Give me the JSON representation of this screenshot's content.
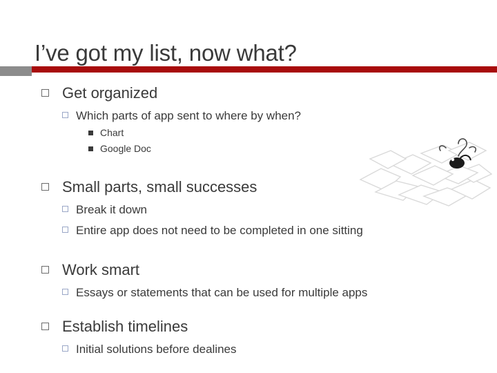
{
  "slide": {
    "title": "I’ve got my list, now what?",
    "colors": {
      "accent_red": "#a80b0b",
      "accent_gray": "#8c8c8c",
      "text": "#3a3a3a",
      "sub_bullet": "#9aa7c7"
    },
    "bullets": [
      {
        "level": 1,
        "text": "Get organized"
      },
      {
        "level": 2,
        "text": "Which parts of app sent to where by when?"
      },
      {
        "level": 3,
        "text": "Chart"
      },
      {
        "level": 3,
        "text": "Google Doc"
      },
      {
        "level": 1,
        "text": "Small parts, small successes"
      },
      {
        "level": 2,
        "text": "Break it down"
      },
      {
        "level": 2,
        "text": "Entire app does not need to be completed in one sitting"
      },
      {
        "level": 1,
        "text": "Work smart"
      },
      {
        "level": 2,
        "text": "Essays or statements that can be used for multiple apps"
      },
      {
        "level": 1,
        "text": "Establish timelines"
      },
      {
        "level": 2,
        "text": "Initial solutions before dealines"
      }
    ]
  }
}
